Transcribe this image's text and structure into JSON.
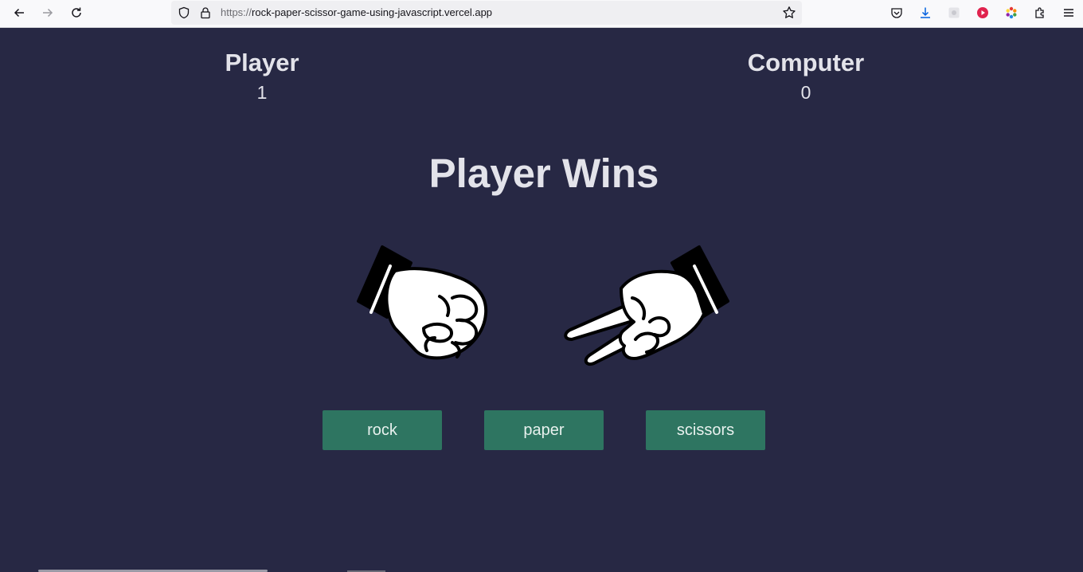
{
  "browser": {
    "url_scheme": "https://",
    "url_host": "rock-paper-scissor-game-using-javascript.vercel.app",
    "icons": [
      "back-arrow-icon",
      "forward-arrow-icon",
      "reload-icon",
      "shield-icon",
      "lock-icon",
      "star-icon",
      "pocket-icon",
      "download-icon",
      "extension-grid-icon",
      "record-icon",
      "color-wheel-icon",
      "extensions-puzzle-icon",
      "menu-icon"
    ]
  },
  "scoreboard": {
    "player": {
      "label": "Player",
      "score": "1"
    },
    "computer": {
      "label": "Computer",
      "score": "0"
    }
  },
  "result": {
    "text": "Player Wins"
  },
  "hands": {
    "player_choice": "rock",
    "computer_choice": "scissors"
  },
  "choices": {
    "rock": "rock",
    "paper": "paper",
    "scissors": "scissors"
  },
  "colors": {
    "background": "#272844",
    "button": "#2e7561",
    "text": "#e3e3ea"
  }
}
